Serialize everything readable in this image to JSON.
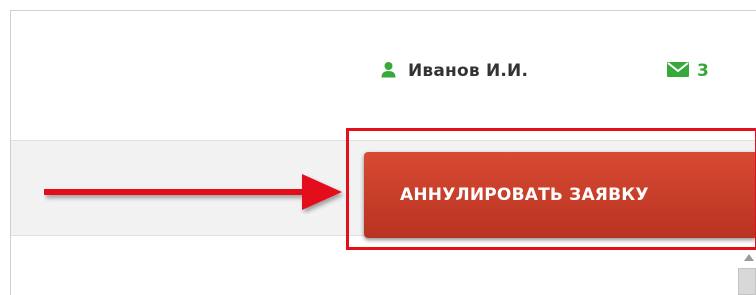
{
  "header": {
    "user_name": "Иванов И.И.",
    "user_icon": "user-icon",
    "messages_icon": "envelope-icon",
    "messages_count": "3"
  },
  "toolbar": {
    "cancel_label": "АННУЛИРОВАТЬ ЗАЯВКУ"
  },
  "annotation": {
    "arrow_icon": "arrow-right-icon",
    "arrow_color": "#e3101b",
    "highlight_color": "#e3101b"
  },
  "colors": {
    "accent_green": "#36a93a",
    "button_red": "#c63d27"
  }
}
